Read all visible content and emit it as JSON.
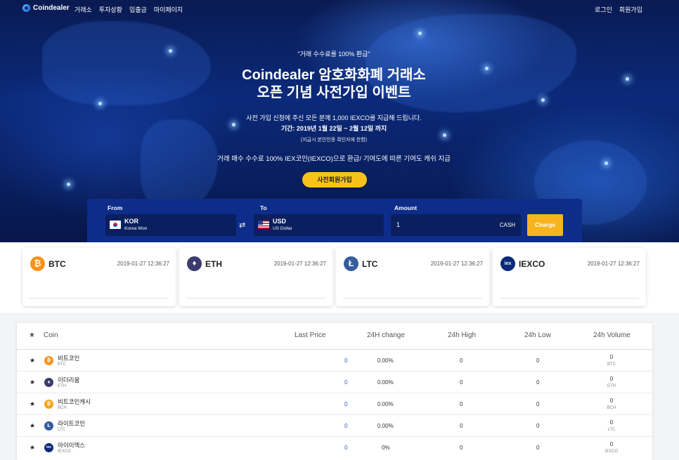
{
  "nav": {
    "logo": "Coindealer",
    "menu": [
      "거래소",
      "투자상황",
      "입출금",
      "마이페이지"
    ],
    "login": "로그인",
    "signup": "회원가입"
  },
  "hero": {
    "quote": "\"거래 수수료를 100% 환급\"",
    "title_line1": "Coindealer 암호화화폐 거래소",
    "title_line2": "오픈 기념 사전가입 이벤트",
    "desc": "사전 가입 신청에 주신 모든 분께 1,000 IEXCO를 지급해 드립니다.",
    "period": "기간: 2019년 1월 22일 ~ 2월 12일 까지",
    "note": "(지급시 본인인증 확인자에 한함)",
    "refund": "거래 매수 수수료 100% IEX코인(IEXCO)으로 환급/ 기여도에 따른 기여도 캐쉬 지급",
    "button": "사전회원가입"
  },
  "exchange": {
    "from_label": "From",
    "to_label": "To",
    "amount_label": "Amount",
    "from_code": "KOR",
    "from_name": "Korea Won",
    "to_code": "USD",
    "to_name": "US Dollar",
    "amount": "1",
    "amount_unit": "CASH",
    "charge": "Charge"
  },
  "cards": [
    {
      "symbol": "BTC",
      "time": "2019-01-27 12:36:27",
      "color": "#f7931a",
      "icon": "bitcoin-icon"
    },
    {
      "symbol": "ETH",
      "time": "2019-01-27 12:36:27",
      "color": "#3c3c6e",
      "icon": "ethereum-icon"
    },
    {
      "symbol": "LTC",
      "time": "2019-01-27 12:36:27",
      "color": "#345d9d",
      "icon": "litecoin-icon"
    },
    {
      "symbol": "IEXCO",
      "time": "2019-01-27 12:36:27",
      "color": "#0b2a7a",
      "icon": "iexco-icon"
    }
  ],
  "table": {
    "headers": {
      "star": "★",
      "coin": "Coin",
      "last_price": "Last Price",
      "change": "24H change",
      "high": "24h High",
      "low": "24h Low",
      "volume": "24h Volume"
    },
    "rows": [
      {
        "name": "비트코인",
        "symbol": "BTC",
        "price": "0",
        "change": "0.00%",
        "high": "0",
        "low": "0",
        "volume": "0",
        "vol_unit": "BTC",
        "color": "#f7931a",
        "glyph": "₿"
      },
      {
        "name": "이더리움",
        "symbol": "ETH",
        "price": "0",
        "change": "0.00%",
        "high": "0",
        "low": "0",
        "volume": "0",
        "vol_unit": "ETH",
        "color": "#3c3c6e",
        "glyph": "♦"
      },
      {
        "name": "비트코인캐시",
        "symbol": "BCH",
        "price": "0",
        "change": "0.00%",
        "high": "0",
        "low": "0",
        "volume": "0",
        "vol_unit": "BCH",
        "color": "#f7a21a",
        "glyph": "₿"
      },
      {
        "name": "라이트코인",
        "symbol": "LTC",
        "price": "0",
        "change": "0.00%",
        "high": "0",
        "low": "0",
        "volume": "0",
        "vol_unit": "LTC",
        "color": "#345d9d",
        "glyph": "Ł"
      },
      {
        "name": "아이이엑스",
        "symbol": "IEXCO",
        "price": "0",
        "change": "0%",
        "high": "0",
        "low": "0",
        "volume": "0",
        "vol_unit": "IEXCO",
        "color": "#0b2a7a",
        "glyph": "iex"
      }
    ]
  }
}
